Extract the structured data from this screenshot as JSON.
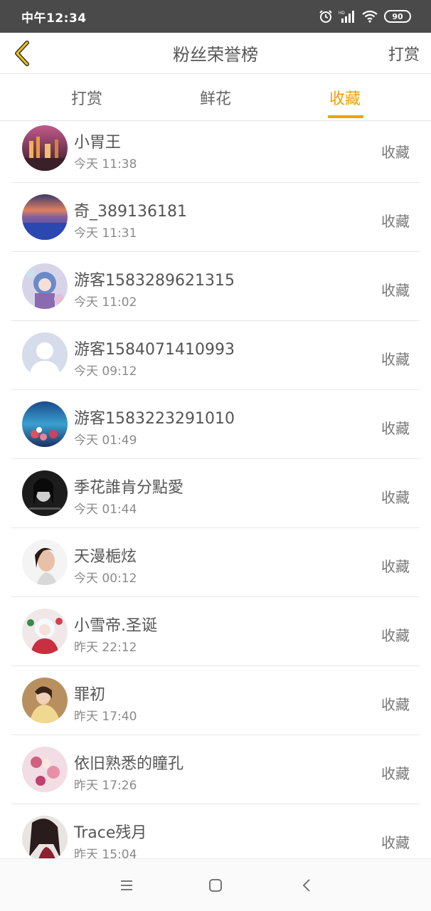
{
  "status_bar": {
    "time": "中午12:34",
    "battery": "90"
  },
  "nav": {
    "title": "粉丝荣誉榜",
    "action": "打赏"
  },
  "tabs": [
    {
      "label": "打赏",
      "active": false
    },
    {
      "label": "鲜花",
      "active": false
    },
    {
      "label": "收藏",
      "active": true
    }
  ],
  "accent_color": "#f0a000",
  "items": [
    {
      "name": "小胃王",
      "time": "今天 11:38",
      "action": "收藏",
      "avatar": "city-night-avatar"
    },
    {
      "name": "奇_389136181",
      "time": "今天 11:31",
      "action": "收藏",
      "avatar": "lavender-sunset-avatar"
    },
    {
      "name": "游客1583289621315",
      "time": "今天 11:02",
      "action": "收藏",
      "avatar": "anime-girl-avatar"
    },
    {
      "name": "游客1584071410993",
      "time": "今天 09:12",
      "action": "收藏",
      "avatar": "default-user-avatar"
    },
    {
      "name": "游客1583223291010",
      "time": "今天 01:49",
      "action": "收藏",
      "avatar": "ocean-flowers-avatar"
    },
    {
      "name": "季花誰肯分點愛",
      "time": "今天 01:44",
      "action": "收藏",
      "avatar": "dark-portrait-avatar"
    },
    {
      "name": "天漫梔炫",
      "time": "今天 00:12",
      "action": "收藏",
      "avatar": "woman-portrait-avatar"
    },
    {
      "name": "小雪帝.圣诞",
      "time": "昨天 22:12",
      "action": "收藏",
      "avatar": "christmas-anime-avatar"
    },
    {
      "name": "罪初",
      "time": "昨天 17:40",
      "action": "收藏",
      "avatar": "girl-sweater-avatar"
    },
    {
      "name": "依旧熟悉的瞳孔",
      "time": "昨天 17:26",
      "action": "收藏",
      "avatar": "floral-kimono-avatar"
    },
    {
      "name": "Trace残月",
      "time": "昨天 15:04",
      "action": "收藏",
      "avatar": "dark-hair-anime-avatar"
    }
  ]
}
